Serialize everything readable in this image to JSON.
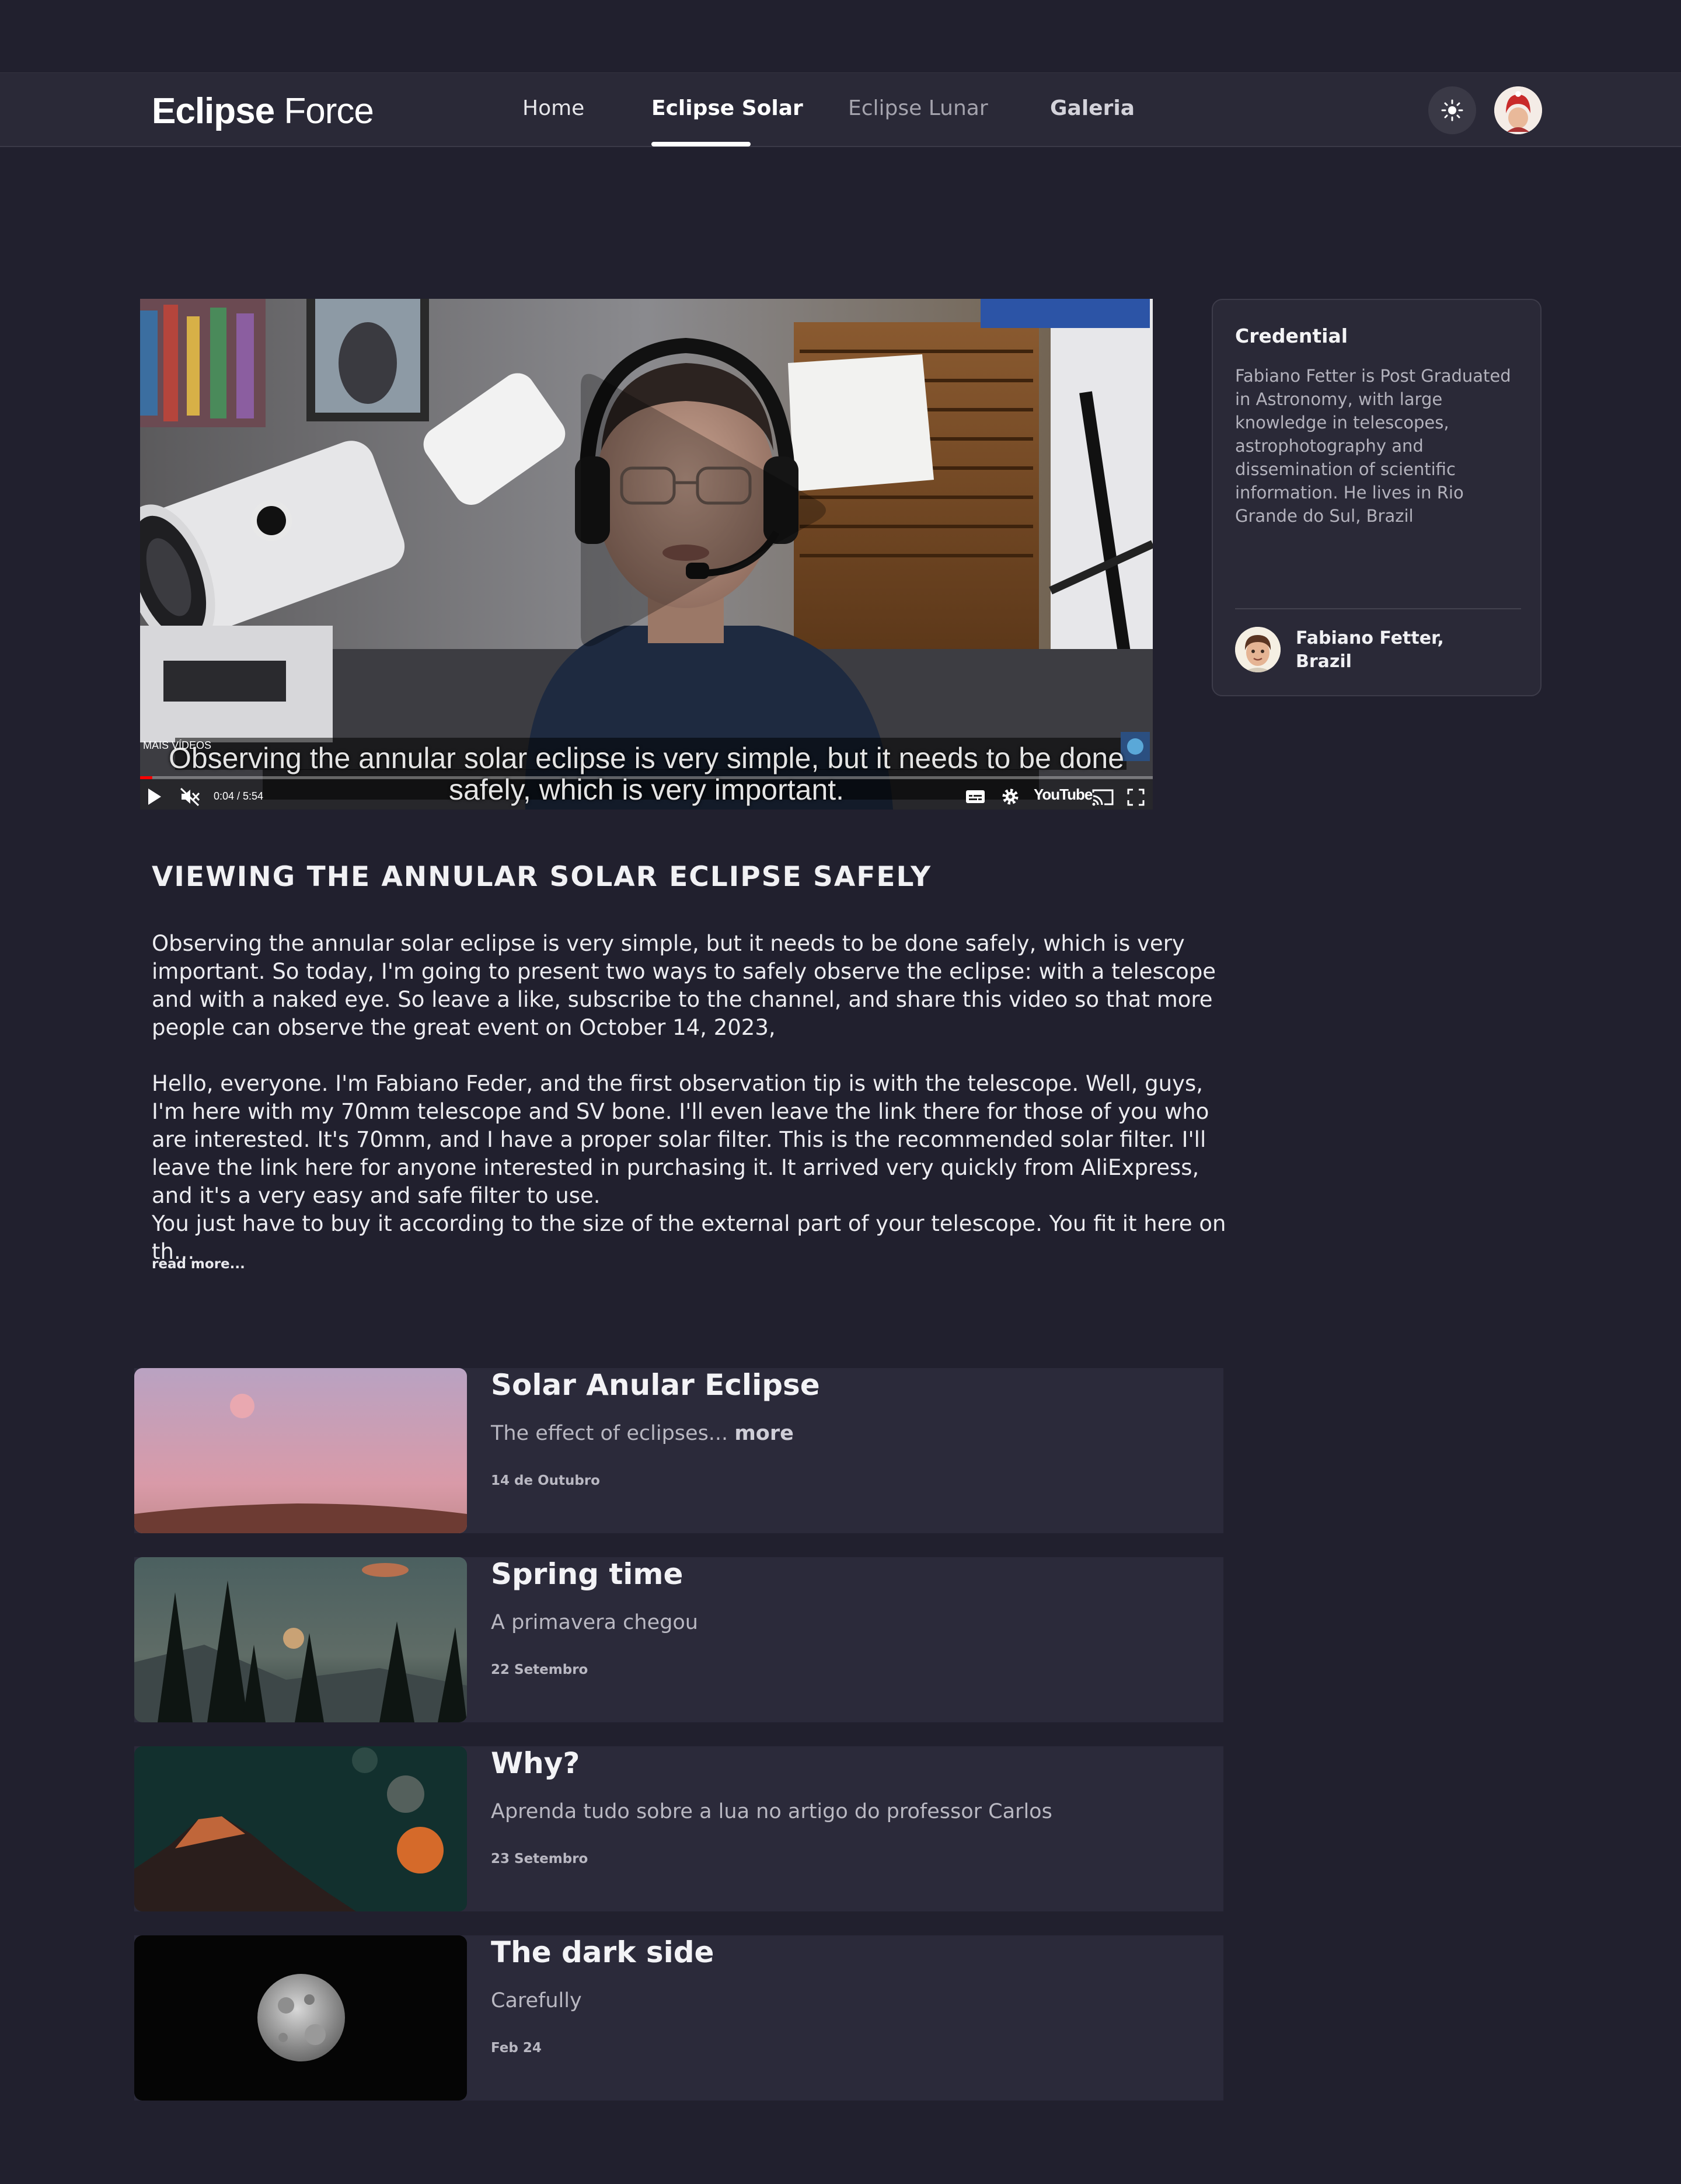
{
  "header": {
    "logo_bold": "Eclipse",
    "logo_light": "Force",
    "nav": [
      "Home",
      "Eclipse Solar",
      "Eclipse Lunar",
      "Galeria"
    ]
  },
  "video": {
    "caption_line1": "Observing the annular solar eclipse is very simple, but it needs to be done",
    "caption_line2": "safely, which is very important.",
    "mais_videos": "MAIS VÍDEOS",
    "timecode": "0:04 / 5:54",
    "provider": "YouTube"
  },
  "credential": {
    "title": "Credential",
    "text": "Fabiano Fetter is Post Graduated in Astronomy, with large knowledge in telescopes, astrophotography and dissemination of scientific information. He lives in Rio Grande do Sul, Brazil",
    "name_line1": "Fabiano Fetter,",
    "name_line2": "Brazil"
  },
  "article": {
    "title": "VIEWING THE ANNULAR SOLAR ECLIPSE SAFELY",
    "para1": "Observing the annular solar eclipse is very simple, but it needs to be done safely, which is very important. So today, I'm going to present two ways to safely observe the eclipse: with a telescope and with a naked eye. So leave a like, subscribe to the channel, and share this video so that more people can observe the great event on October 14, 2023,",
    "para2": "Hello, everyone. I'm Fabiano Feder, and the first observation tip is with the telescope. Well, guys, I'm here with my 70mm telescope and SV bone. I'll even leave the link there for those of you who are interested. It's 70mm, and I have a proper solar filter. This is the recommended solar filter. I'll leave the link here for anyone interested in purchasing it. It arrived very quickly from AliExpress, and it's a very easy and safe filter to use.",
    "para3": "You just have to buy it according to the size of the external part of your telescope. You fit it here on th...",
    "read_more": "read more..."
  },
  "posts": [
    {
      "title": "Solar Anular Eclipse",
      "subtitle": "The effect of eclipses...",
      "more": "more",
      "date": "14 de Outubro"
    },
    {
      "title": "Spring time",
      "subtitle": "A primavera chegou",
      "date": "22 Setembro"
    },
    {
      "title": "Why?",
      "subtitle": "Aprenda tudo sobre a lua no artigo do professor Carlos",
      "date": "23 Setembro"
    },
    {
      "title": "The dark side",
      "subtitle": "Carefully",
      "date": "Feb 24"
    }
  ],
  "colors": {
    "background": "#21202e",
    "header": "#2a2937",
    "card": "#2b2a3a",
    "progress_red": "#ff0000"
  },
  "icons": {
    "theme": "sun-icon",
    "play": "play-icon",
    "mute": "mute-icon",
    "subtitles": "subtitles-icon",
    "settings": "gear-icon",
    "cast": "cast-icon",
    "fullscreen": "fullscreen-icon"
  },
  "video_progress": 0.012
}
